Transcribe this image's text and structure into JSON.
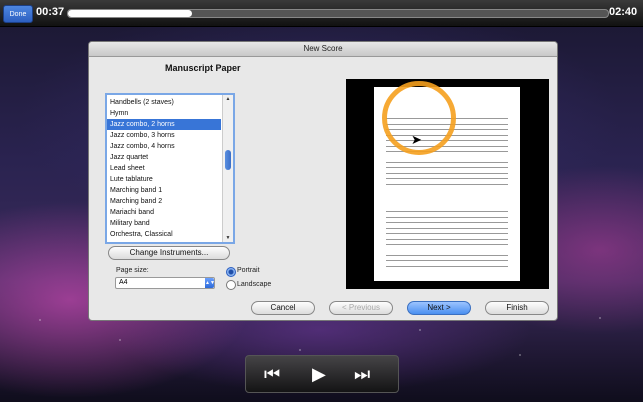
{
  "player": {
    "done_label": "Done",
    "time_elapsed": "00:37",
    "time_remaining": "02:40",
    "progress_fraction": 0.23
  },
  "dialog": {
    "title": "New Score",
    "heading": "Manuscript Paper",
    "list_items": [
      "Handbells (2 staves)",
      "Hymn",
      "Jazz combo, 2 horns",
      "Jazz combo, 3 horns",
      "Jazz combo, 4 horns",
      "Jazz quartet",
      "Lead sheet",
      "Lute tablature",
      "Marching band 1",
      "Marching band 2",
      "Mariachi band",
      "Military band",
      "Orchestra, Classical"
    ],
    "selected_item": "Jazz combo, 2 horns",
    "change_instruments_label": "Change Instruments...",
    "page_size_label": "Page size:",
    "page_size_value": "A4",
    "portrait_label": "Portrait",
    "landscape_label": "Landscape",
    "orientation_selected": "Portrait",
    "cancel_label": "Cancel",
    "previous_label": "< Previous",
    "next_label": "Next >",
    "finish_label": "Finish"
  },
  "icons": {
    "rewind": "rewind-icon",
    "play": "play-icon",
    "fast_forward": "fast-forward-icon"
  }
}
